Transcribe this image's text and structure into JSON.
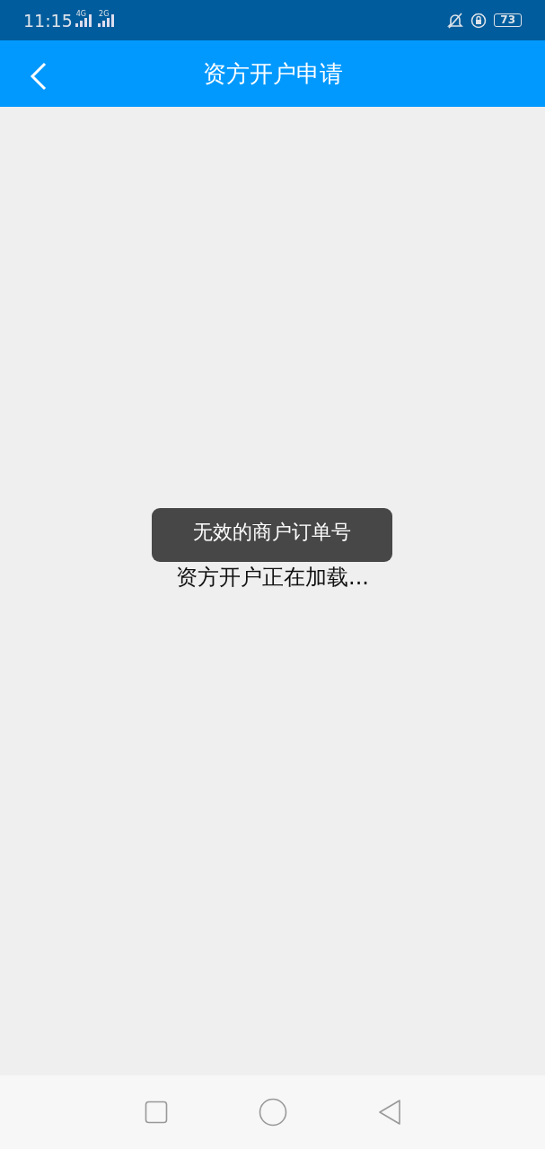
{
  "status_bar": {
    "time": "11:15",
    "networks": [
      "4G",
      "2G"
    ],
    "battery": "73"
  },
  "header": {
    "title": "资方开户申请"
  },
  "content": {
    "loading_text": "资方开户正在加载..."
  },
  "toast": {
    "message": "无效的商户订单号"
  }
}
